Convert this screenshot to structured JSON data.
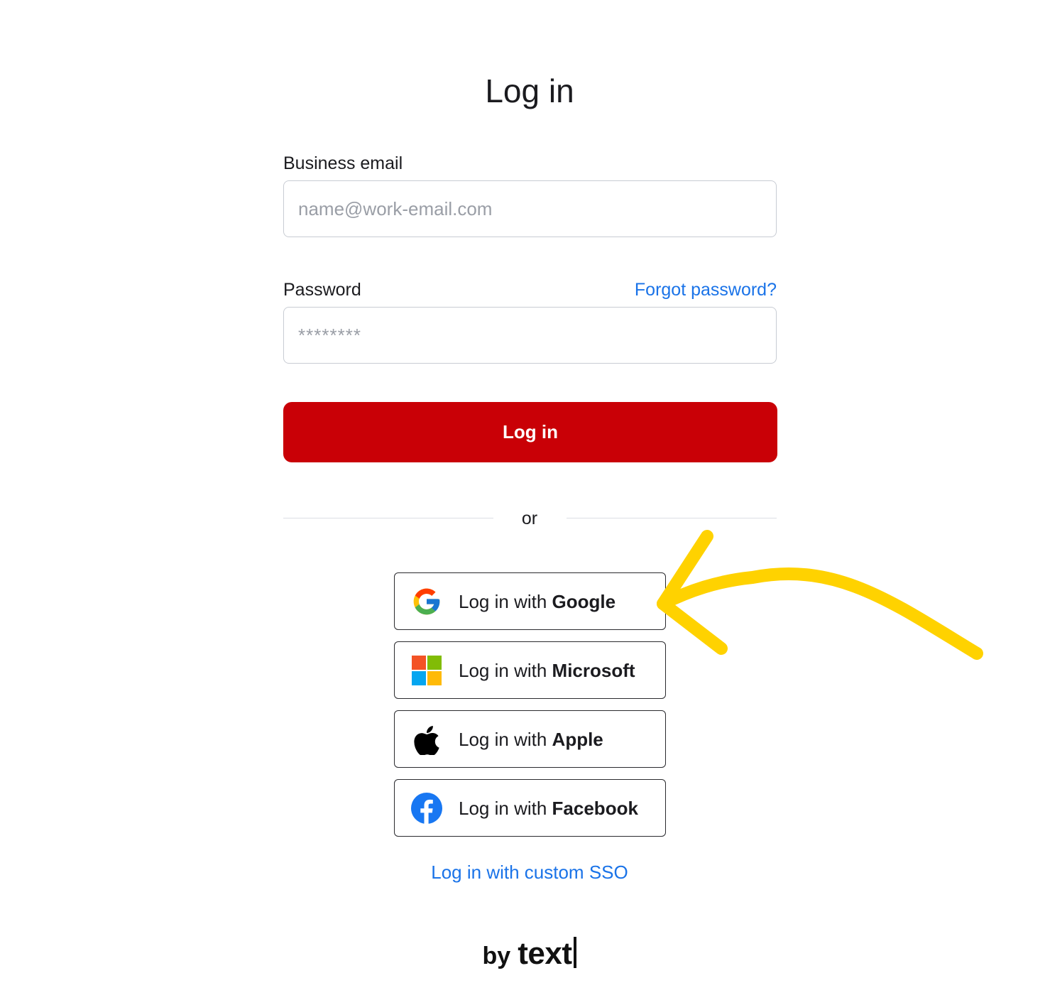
{
  "title": "Log in",
  "email": {
    "label": "Business email",
    "placeholder": "name@work-email.com",
    "value": ""
  },
  "password": {
    "label": "Password",
    "forgot_label": "Forgot password?",
    "placeholder": "********",
    "value": ""
  },
  "login_button_label": "Log in",
  "divider_text": "or",
  "social": {
    "prefix": "Log in with",
    "google": {
      "provider": "Google",
      "icon": "google-icon"
    },
    "microsoft": {
      "provider": "Microsoft",
      "icon": "microsoft-icon"
    },
    "apple": {
      "provider": "Apple",
      "icon": "apple-icon"
    },
    "facebook": {
      "provider": "Facebook",
      "icon": "facebook-icon"
    }
  },
  "sso_link_label": "Log in with custom SSO",
  "footer": {
    "by": "by",
    "brand": "text"
  },
  "colors": {
    "primary_button": "#c90006",
    "link": "#1a73e8",
    "annotation_arrow": "#ffd200"
  }
}
